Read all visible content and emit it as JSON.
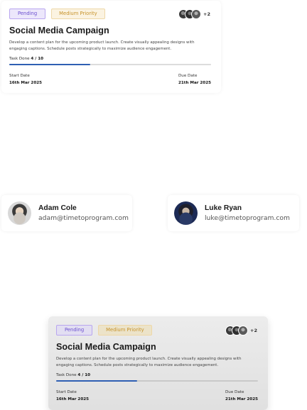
{
  "cards": [
    {
      "status_label": "Pending",
      "priority_label": "Medium Priority",
      "extra_members": "+2",
      "title": "Social Media Campaign",
      "description": "Develop a content plan for the upcoming product launch. Create visually appealing designs with engaging captions. Schedule posts strategically to maximize audience engagement.",
      "task_done_label": "Task Done",
      "task_done_value": "4 / 10",
      "progress": 0.4,
      "progress_color": "#2f5fb3",
      "start_label": "Start Date",
      "start_value": "16th Mar 2025",
      "due_label": "Due Date",
      "due_value": "21th Mar 2025"
    },
    {
      "status_label": "Pending",
      "priority_label": "Medium Priority",
      "extra_members": "+2",
      "title": "Social Media Campaign",
      "description": "Develop a content plan for the upcoming product launch. Create visually appealing designs with engaging captions. Schedule posts strategically to maximize audience engagement.",
      "task_done_label": "Task Done",
      "task_done_value": "4 / 10",
      "progress": 0.4,
      "progress_color": "#2f5fb3",
      "start_label": "Start Date",
      "start_value": "16th Mar 2025",
      "due_label": "Due Date",
      "due_value": "21th Mar 2025"
    }
  ],
  "contacts": [
    {
      "name": "Adam Cole",
      "email": "adam@timetoprogram.com",
      "avatar_icon": "user-avatar"
    },
    {
      "name": "Luke Ryan",
      "email": "luke@timetoprogram.com",
      "avatar_icon": "user-avatar"
    }
  ]
}
